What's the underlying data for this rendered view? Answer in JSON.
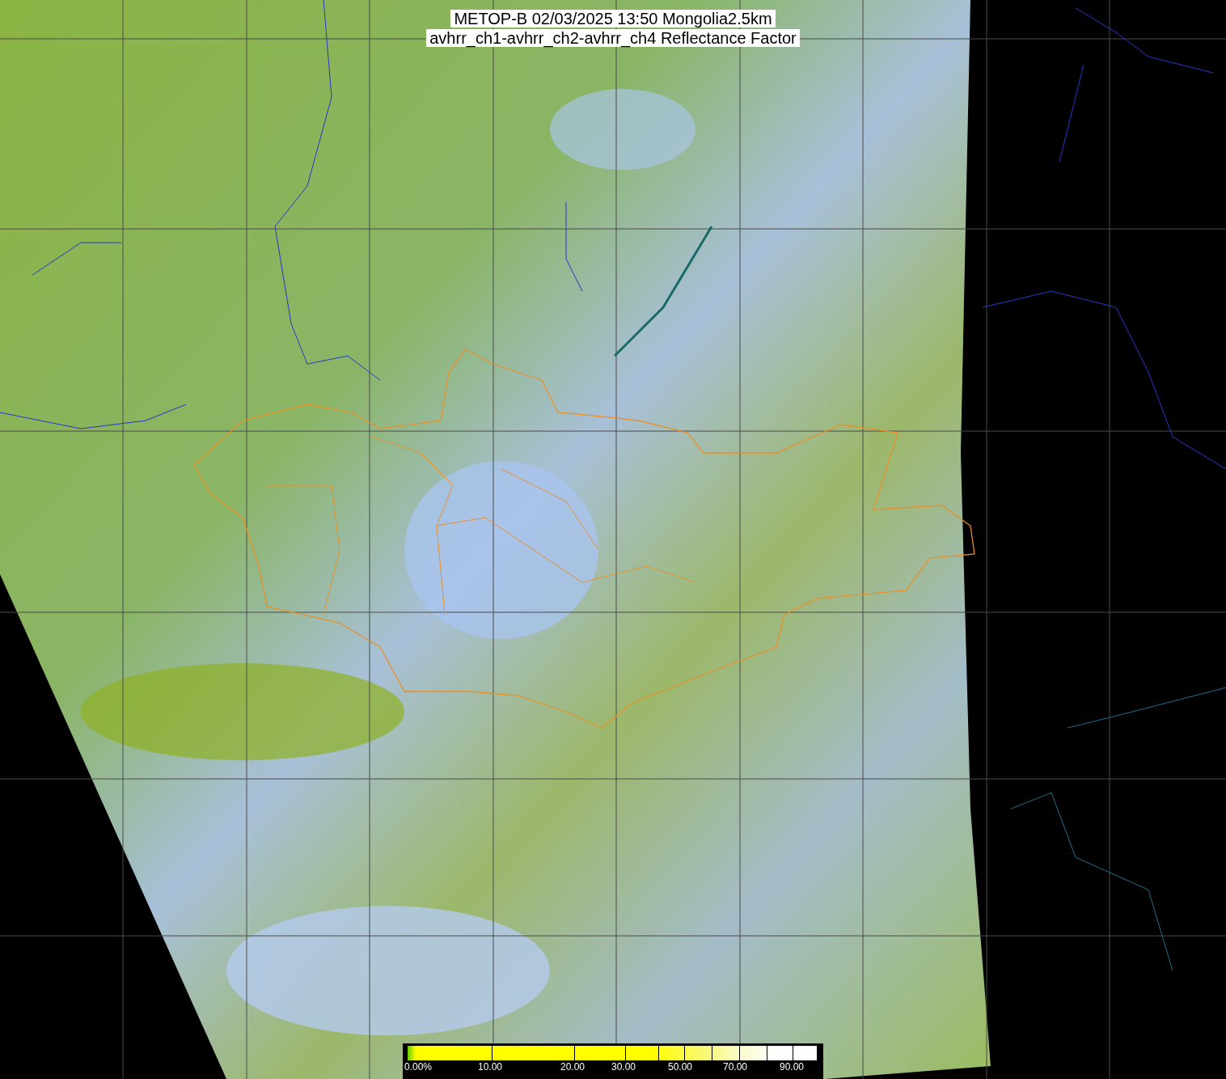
{
  "title": [
    "METOP-B 02/03/2025 13:50 Mongolia2.5km",
    "avhrr_ch1-avhrr_ch2-avhrr_ch4 Reflectance Factor"
  ],
  "legend": {
    "labels": [
      "0.00%",
      "10.00",
      "20.00",
      "30.00",
      "50.00",
      "70.00",
      "90.00"
    ]
  }
}
